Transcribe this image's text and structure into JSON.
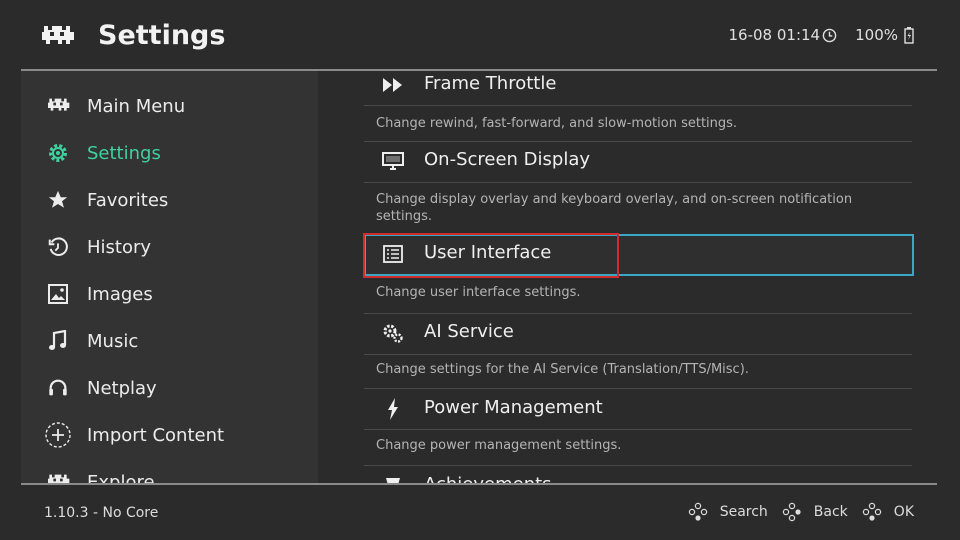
{
  "header": {
    "title": "Settings",
    "datetime": "16-08 01:14",
    "battery": "100%",
    "logo_icon": "retroarch-invader-icon",
    "clock_icon": "clock-icon",
    "battery_icon": "battery-icon"
  },
  "sidebar": {
    "items": [
      {
        "label": "Main Menu",
        "icon": "invader-icon"
      },
      {
        "label": "Settings",
        "icon": "gear-icon",
        "active": true
      },
      {
        "label": "Favorites",
        "icon": "star-icon"
      },
      {
        "label": "History",
        "icon": "history-icon"
      },
      {
        "label": "Images",
        "icon": "image-icon"
      },
      {
        "label": "Music",
        "icon": "music-note-icon"
      },
      {
        "label": "Netplay",
        "icon": "headset-icon"
      },
      {
        "label": "Import Content",
        "icon": "plus-circle-icon"
      },
      {
        "label": "Explore",
        "icon": "invader-icon"
      }
    ]
  },
  "content": {
    "entries": [
      {
        "label": "Frame Throttle",
        "desc": "Change rewind, fast-forward, and slow-motion settings.",
        "icon": "fast-forward-icon"
      },
      {
        "label": "On-Screen Display",
        "desc": "Change display overlay and keyboard overlay, and on-screen notification settings.",
        "icon": "monitor-icon"
      },
      {
        "label": "User Interface",
        "desc": "Change user interface settings.",
        "icon": "list-icon",
        "selected": true
      },
      {
        "label": "AI Service",
        "desc": "Change settings for the AI Service (Translation/TTS/Misc).",
        "icon": "gears-icon"
      },
      {
        "label": "Power Management",
        "desc": "Change power management settings.",
        "icon": "lightning-icon"
      },
      {
        "label": "Achievements",
        "icon": "trophy-icon"
      }
    ]
  },
  "footer": {
    "version": "1.10.3 - No Core",
    "actions": [
      {
        "label": "Search",
        "icon": "gamepad-buttons-icon"
      },
      {
        "label": "Back",
        "icon": "gamepad-buttons-icon"
      },
      {
        "label": "OK",
        "icon": "gamepad-buttons-icon"
      }
    ]
  },
  "colors": {
    "accent_active": "#3fd1a0",
    "selection_border": "#3aa8c4",
    "highlight_red": "#d22b2b",
    "background": "#2b2b2b",
    "sidebar_bg": "#333333"
  }
}
